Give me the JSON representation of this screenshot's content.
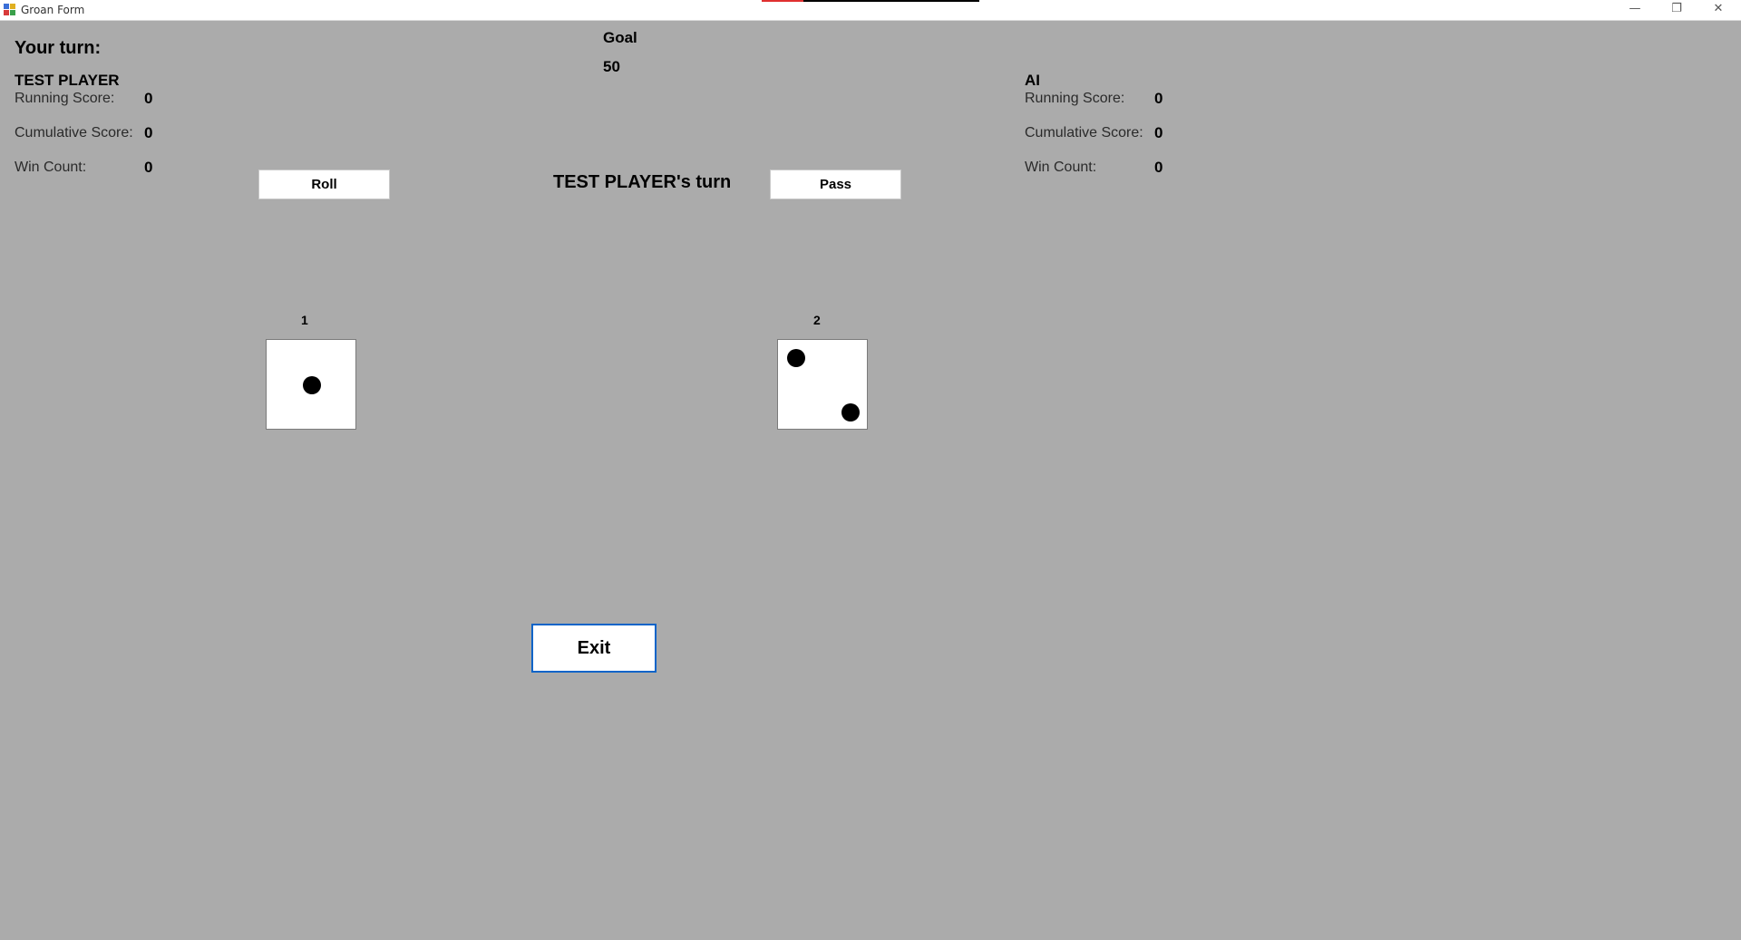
{
  "window": {
    "title": "Groan Form",
    "progress_fraction": 0.19,
    "controls": {
      "minimize": "—",
      "maximize": "❐",
      "close": "✕"
    }
  },
  "header": {
    "turn_prompt": "Your turn:",
    "goal_label": "Goal",
    "goal_value": "50"
  },
  "player": {
    "name": "TEST PLAYER",
    "running_label": "Running Score:",
    "running_value": "0",
    "cumulative_label": "Cumulative Score:",
    "cumulative_value": "0",
    "win_label": "Win Count:",
    "win_value": "0"
  },
  "ai": {
    "name": "AI",
    "running_label": "Running Score:",
    "running_value": "0",
    "cumulative_label": "Cumulative Score:",
    "cumulative_value": "0",
    "win_label": "Win Count:",
    "win_value": "0"
  },
  "controls": {
    "roll_label": "Roll",
    "pass_label": "Pass",
    "turn_status": "TEST PLAYER's turn",
    "exit_label": "Exit"
  },
  "dice": [
    {
      "label": "1",
      "value": 1
    },
    {
      "label": "2",
      "value": 2
    }
  ],
  "colors": {
    "background": "#ababab",
    "exit_border": "#0a64c8"
  }
}
